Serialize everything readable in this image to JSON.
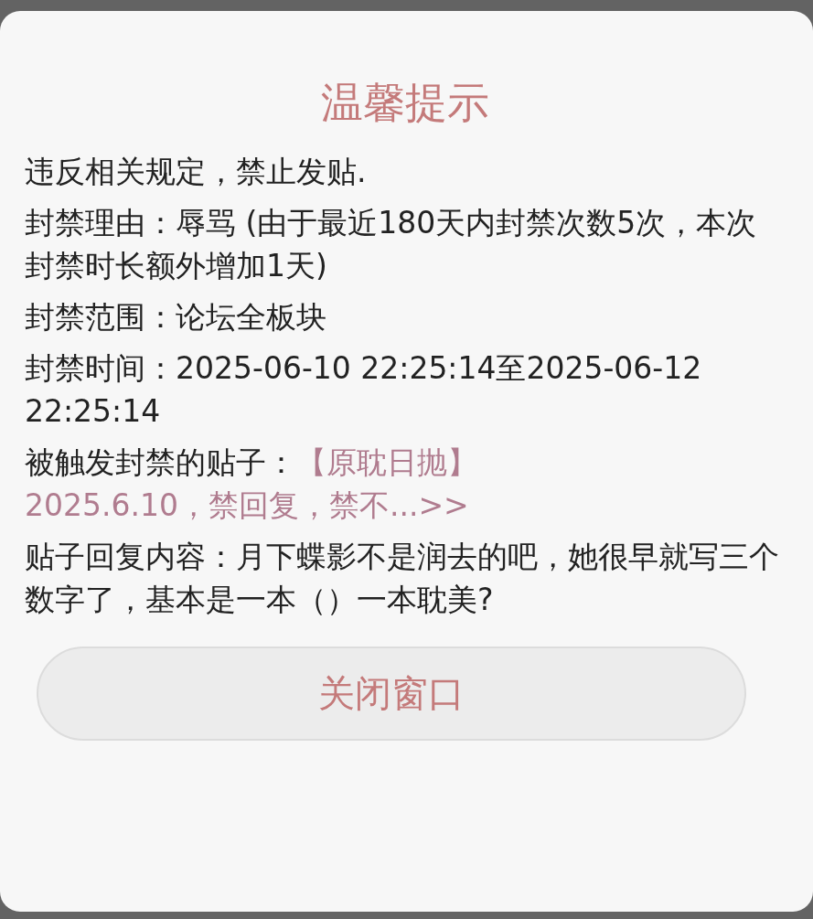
{
  "dialog": {
    "title": "温馨提示",
    "paragraphs": [
      {
        "kind": "text",
        "text": "违反相关规定，禁止发贴."
      },
      {
        "kind": "text",
        "text": "封禁理由：辱骂 (由于最近180天内封禁次数5次，本次封禁时长额外增加1天)"
      },
      {
        "kind": "text",
        "text": "封禁范围：论坛全板块"
      },
      {
        "kind": "text",
        "text": "封禁时间：2025-06-10 22:25:14至2025-06-12 22:25:14"
      },
      {
        "kind": "link",
        "text": "被触发封禁的贴子：",
        "link": [
          "【原耽日抛】",
          "2025.6.10，禁回复，禁不...>>"
        ]
      },
      {
        "kind": "text",
        "text": "贴子回复内容：月下蝶影不是润去的吧，她很早就写三个数字了，基本是一本（）一本耽美?"
      }
    ],
    "button": "关闭窗口"
  }
}
